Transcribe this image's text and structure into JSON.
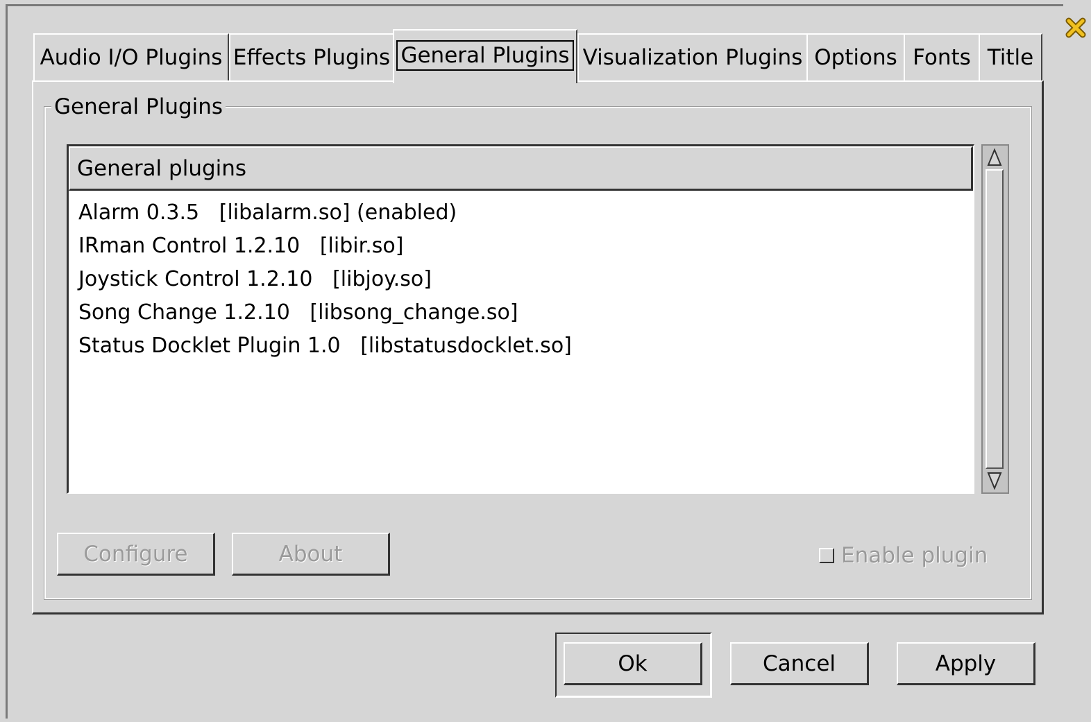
{
  "tabs": [
    {
      "label": "Audio I/O Plugins"
    },
    {
      "label": "Effects Plugins"
    },
    {
      "label": "General Plugins"
    },
    {
      "label": "Visualization Plugins"
    },
    {
      "label": "Options"
    },
    {
      "label": "Fonts"
    },
    {
      "label": "Title"
    }
  ],
  "active_tab": "General Plugins",
  "group": {
    "title": "General Plugins"
  },
  "list": {
    "header": "General plugins",
    "rows": [
      "Alarm 0.3.5   [libalarm.so] (enabled)",
      "IRman Control 1.2.10   [libir.so]",
      "Joystick Control 1.2.10   [libjoy.so]",
      "Song Change 1.2.10   [libsong_change.so]",
      "Status Docklet Plugin 1.0   [libstatusdocklet.so]"
    ]
  },
  "buttons": {
    "configure": "Configure",
    "about": "About",
    "enable_plugin": "Enable plugin",
    "ok": "Ok",
    "cancel": "Cancel",
    "apply": "Apply"
  },
  "icons": {
    "close": "close-icon",
    "scroll_up": "triangle-up-icon",
    "scroll_down": "triangle-down-icon"
  },
  "colors": {
    "background": "#d6d6d6",
    "close_icon": "#e0b020"
  }
}
